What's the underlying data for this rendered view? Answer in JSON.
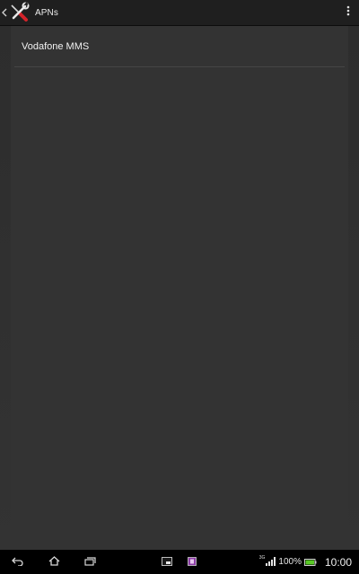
{
  "action_bar": {
    "title": "APNs",
    "back_icon": "chevron-left-icon",
    "app_icon": "wrench-screwdriver-icon",
    "overflow_icon": "overflow-menu-icon"
  },
  "apn_list": {
    "items": [
      {
        "label": "Vodafone MMS"
      }
    ]
  },
  "nav_bar": {
    "back_icon": "back-arrow-icon",
    "home_icon": "home-icon",
    "recents_icon": "recent-apps-icon",
    "small_app_icons": [
      "small-app-window-icon",
      "small-app-purple-icon"
    ]
  },
  "status": {
    "network_type": "3G",
    "battery": "100%",
    "time": "10:00",
    "colors": {
      "battery_fill": "#59c926",
      "small_app_purple": "#8e3ea8"
    }
  }
}
